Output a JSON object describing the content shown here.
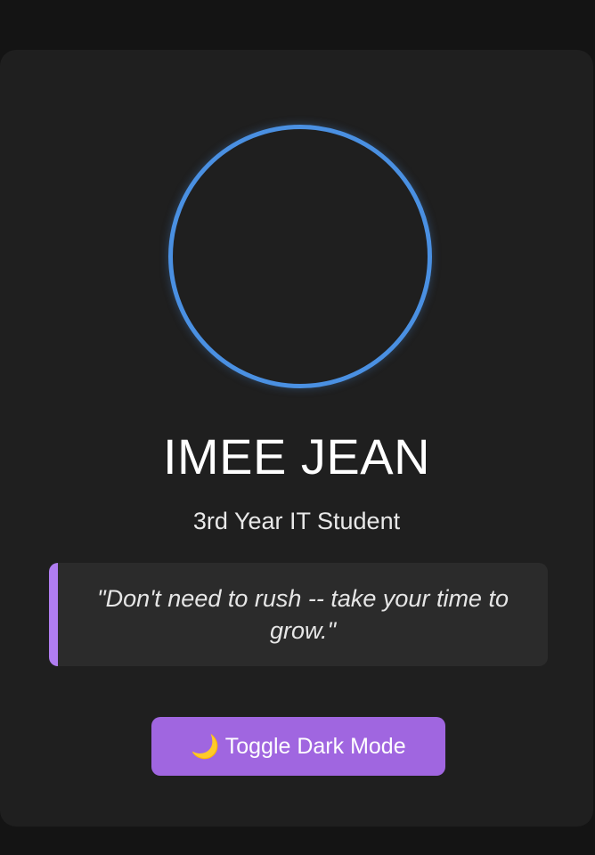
{
  "profile": {
    "name": "IMEE JEAN",
    "role": "3rd Year IT Student",
    "quote": "\"Don't need to rush -- take your time to grow.\""
  },
  "toggle": {
    "icon": "moon-icon",
    "icon_glyph": "🌙",
    "label": "Toggle Dark Mode"
  },
  "colors": {
    "page_background": "#141414",
    "card_background": "#1f1f1f",
    "avatar_ring": "#4a90e2",
    "quote_accent": "#b07df0",
    "button_background": "#a066e0"
  }
}
